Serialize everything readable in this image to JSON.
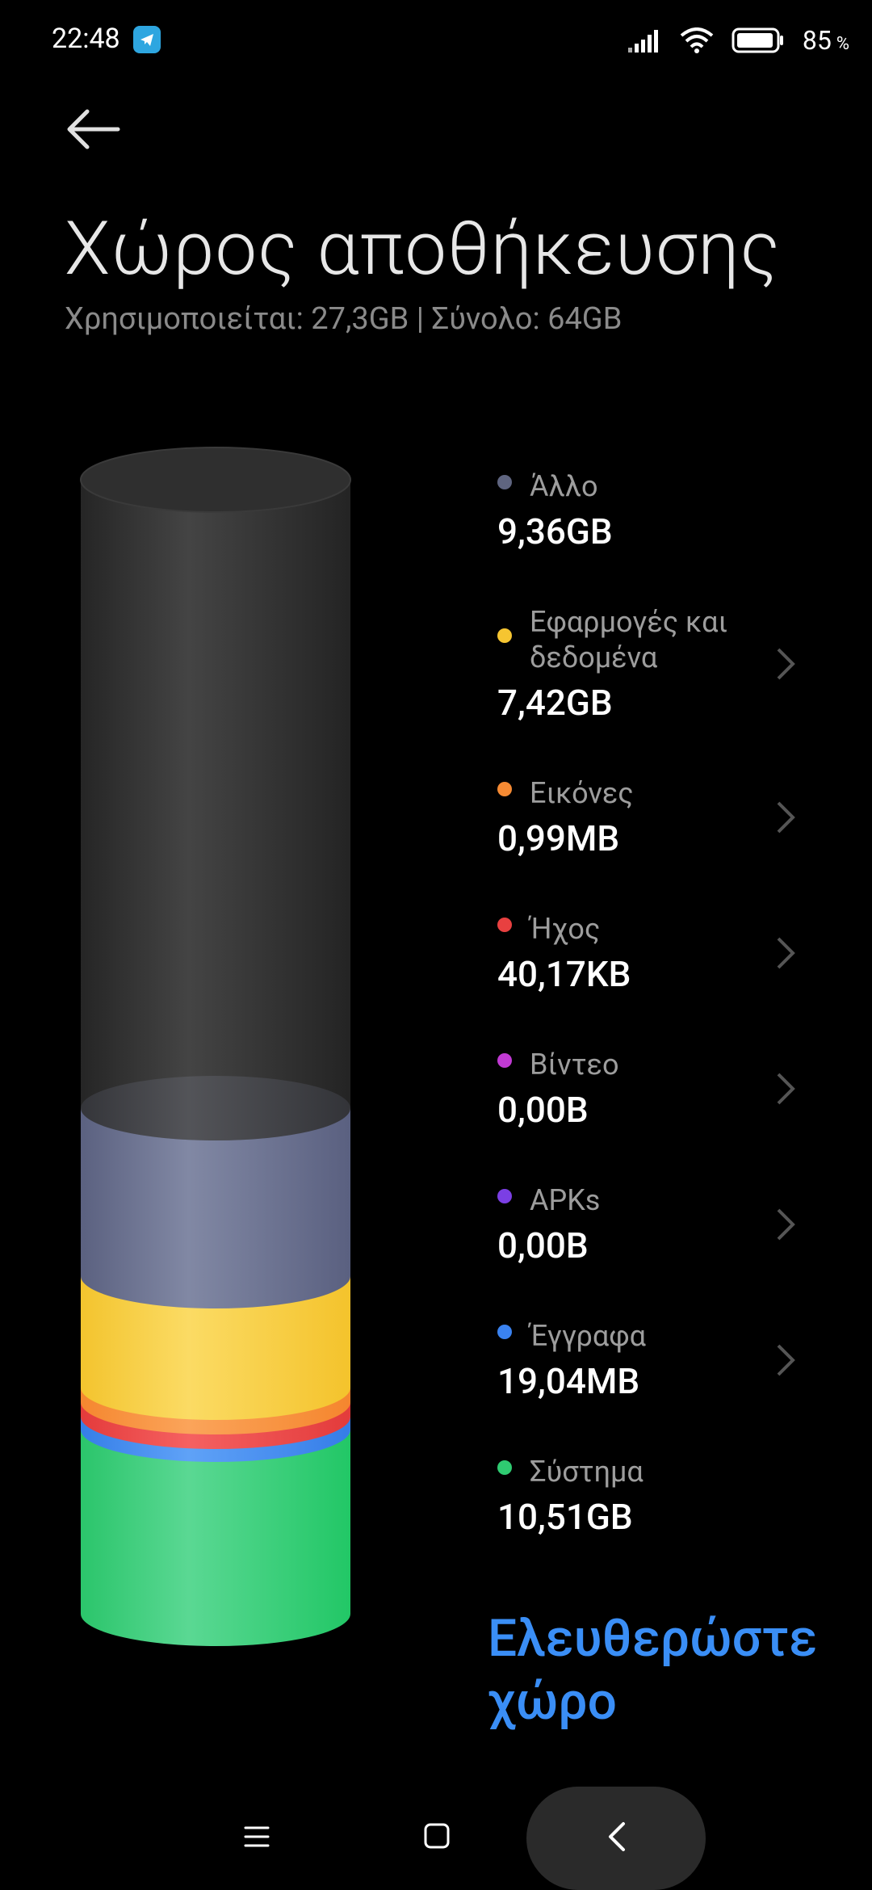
{
  "status_bar": {
    "time": "22:48",
    "battery_percent": "85",
    "battery_percent_sign": "%",
    "icons": [
      "telegram-icon",
      "signal-icon",
      "wifi-icon",
      "battery-icon"
    ]
  },
  "header": {
    "title": "Χώρος αποθήκευσης",
    "subtitle": "Χρησιμοποιείται: 27,3GB | Σύνολο: 64GB"
  },
  "storage": {
    "used": "27,3GB",
    "total": "64GB",
    "categories": [
      {
        "label": "Άλλο",
        "value": "9,36GB",
        "color": "#5f6580",
        "has_chevron": false
      },
      {
        "label": "Εφαρμογές και δεδομένα",
        "value": "7,42GB",
        "color": "#f6c531",
        "has_chevron": true
      },
      {
        "label": "Εικόνες",
        "value": "0,99MB",
        "color": "#f58a33",
        "has_chevron": true
      },
      {
        "label": "Ήχος",
        "value": "40,17KB",
        "color": "#e84040",
        "has_chevron": true
      },
      {
        "label": "Βίντεο",
        "value": "0,00B",
        "color": "#c13ad3",
        "has_chevron": true
      },
      {
        "label": "APKs",
        "value": "0,00B",
        "color": "#7b3fe4",
        "has_chevron": true
      },
      {
        "label": "Έγγραφα",
        "value": "19,04MB",
        "color": "#3a82f0",
        "has_chevron": true
      },
      {
        "label": "Σύστημα",
        "value": "10,51GB",
        "color": "#2fcb71",
        "has_chevron": false
      }
    ]
  },
  "free_space_button": "Ελευθερώστε χώρο",
  "nav_bar": {
    "icons": [
      "menu-icon",
      "home-icon",
      "back-icon"
    ]
  }
}
